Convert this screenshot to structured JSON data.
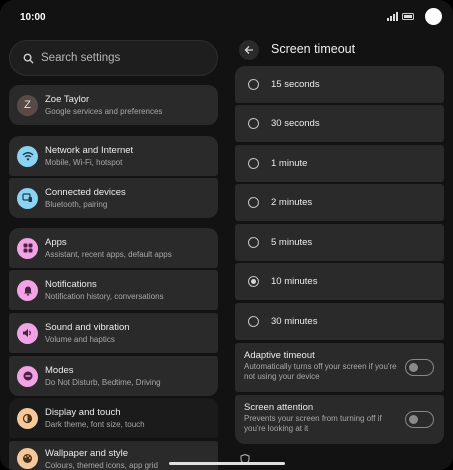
{
  "status_bar": {
    "time": "10:00"
  },
  "search": {
    "placeholder": "Search settings"
  },
  "left_list": [
    {
      "id": "account",
      "title": "Zoe Taylor",
      "subtitle": "Google services and preferences",
      "icon": "avatar",
      "initial": "Z",
      "color": "#5a4a45"
    },
    {
      "id": "network",
      "title": "Network and Internet",
      "subtitle": "Mobile, Wi-Fi, hotspot",
      "icon": "wifi-icon",
      "color": "#8ad3f5"
    },
    {
      "id": "connected",
      "title": "Connected devices",
      "subtitle": "Bluetooth, pairing",
      "icon": "devices-icon",
      "color": "#8ad3f5"
    },
    {
      "id": "apps",
      "title": "Apps",
      "subtitle": "Assistant, recent apps, default apps",
      "icon": "apps-icon",
      "color": "#f2a3e6"
    },
    {
      "id": "notifications",
      "title": "Notifications",
      "subtitle": "Notification history, conversations",
      "icon": "bell-icon",
      "color": "#f2a3e6"
    },
    {
      "id": "sound",
      "title": "Sound and vibration",
      "subtitle": "Volume and haptics",
      "icon": "speaker-icon",
      "color": "#f2a3e6"
    },
    {
      "id": "modes",
      "title": "Modes",
      "subtitle": "Do Not Disturb, Bedtime, Driving",
      "icon": "modes-icon",
      "color": "#f2a3e6"
    },
    {
      "id": "display",
      "title": "Display and touch",
      "subtitle": "Dark theme, font size, touch",
      "icon": "display-icon",
      "color": "#f5c89a"
    },
    {
      "id": "wallpaper",
      "title": "Wallpaper and style",
      "subtitle": "Colours, themed icons, app grid",
      "icon": "palette-icon",
      "color": "#f5c89a"
    }
  ],
  "detail": {
    "title": "Screen timeout",
    "options": [
      "15 seconds",
      "30 seconds",
      "1 minute",
      "2 minutes",
      "5 minutes",
      "10 minutes",
      "30 minutes"
    ],
    "selected_option": "10 minutes",
    "toggles": [
      {
        "title": "Adaptive timeout",
        "description": "Automatically turns off your screen if you're not using your device",
        "on": false
      },
      {
        "title": "Screen attention",
        "description": "Prevents your screen from turning off if you're looking at it",
        "on": false
      }
    ]
  }
}
